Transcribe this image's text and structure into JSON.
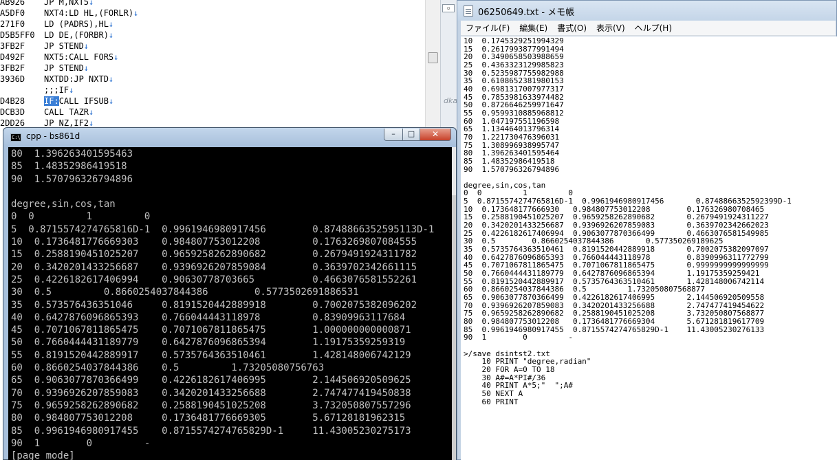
{
  "background_editor": {
    "lines": [
      {
        "addr": "AB926",
        "code": "JP M,NXT5"
      },
      {
        "addr": "A5DF0",
        "code": "NXT4:LD HL,(FORLR)"
      },
      {
        "addr": "271F0",
        "code": "LD (PADRS),HL"
      },
      {
        "addr": "D5B5FF0",
        "code": "LD DE,(FORBR)"
      },
      {
        "addr": "3FB2F",
        "code": "JP STEND"
      },
      {
        "addr": "D492F",
        "code": "NXT5:CALL FORS"
      },
      {
        "addr": "3FB2F",
        "code": "JP STEND"
      },
      {
        "addr": "3936D",
        "code": "NXTDD:JP NXTD"
      },
      {
        "addr": "",
        "code": ";;;IF"
      },
      {
        "addr": "D4B28",
        "code_hl": "IF:",
        "code": "CALL IFSUB"
      },
      {
        "addr": "DCB3D",
        "code": "CALL TAZR"
      },
      {
        "addr": "2DD26",
        "code": "JP NZ,IF2"
      }
    ],
    "arrow": "↓",
    "strip_fragment": "dka"
  },
  "notepad": {
    "title": "06250649.txt - メモ帳",
    "menu": [
      "ファイル(F)",
      "編集(E)",
      "書式(O)",
      "表示(V)",
      "ヘルプ(H)"
    ],
    "content": "10  0.1745329251994329\n15  0.2617993877991494\n20  0.3490658503988659\n25  0.4363323129985823\n30  0.5235987755982988\n35  0.6108652381980153\n40  0.6981317007977317\n45  0.7853981633974482\n50  0.8726646259971647\n55  0.9599310885968812\n60  1.047197551196598\n65  1.134464013796314\n70  1.221730476396031\n75  1.308996938995747\n80  1.396263401595464\n85  1.48352986419518\n90  1.570796326794896\n\ndegree,sin,cos,tan\n0  0         1         0\n5  0.8715574274765816D-1  0.9961946980917456       0.8748866352592399D-1\n10  0.173648177666930   0.984807753012208        0.176326980708465\n15  0.2588190451025207  0.9659258262890682       0.2679491924311227\n20  0.3420201433256687  0.9396926207859083       0.3639702342662023\n25  0.4226182617406994  0.9063077870366499       0.4663076581549985\n30  0.5        0.8660254037844386       0.577350269189625\n35  0.5735764363510461  0.8191520442889918       0.7002075382097097\n40  0.6427876096865393  0.766044443118978        0.8390996311772799\n45  0.7071067811865475  0.7071067811865475       0.9999999999999999\n50  0.7660444431189779  0.6427876096865394       1.19175359259421\n55  0.8191520442889917  0.5735764363510461       1.428148006742114\n60  0.8660254037844386  0.5         1.732050807568877\n65  0.9063077870366499  0.4226182617406995       2.144506920509558\n70  0.9396926207859083  0.3420201433256688       2.747477419454622\n75  0.9659258262890682  0.2588190451025208       3.732050807568877\n80  0.984807753012208   0.1736481776669304       5.671281819617709\n85  0.9961946980917455  0.8715574274765829D-1    11.43005230276133\n90  1        0         -\n\n>/save dsintst2.txt\n    10 PRINT \"degree,radian\"\n    20 FOR A=0 TO 18\n    30 A#=A*PI#/36\n    40 PRINT A*5;\"  \";A#\n    50 NEXT A\n    60 PRINT"
  },
  "console": {
    "title": "cpp - bs861d",
    "icon_text": "C:\\",
    "buttons": {
      "minimize": "–",
      "maximize": "□",
      "close": "✕"
    },
    "content": "80  1.396263401595463\n85  1.48352986419518\n90  1.570796326794896\n\ndegree,sin,cos,tan\n0  0         1         0\n5  0.8715574274765816D-1  0.9961946980917456        0.8748866352595113D-1\n10  0.1736481776669303    0.984807753012208         0.1763269807084555\n15  0.2588190451025207    0.9659258262890682        0.2679491924311782\n20  0.3420201433256687    0.9396926207859084        0.3639702342661115\n25  0.4226182617406994    0.90630778703665          0.4663076581552261\n30  0.5         0.8660254037844386        0.5773502691886531\n35  0.573576436351046     0.8191520442889918        0.7002075382096202\n40  0.6427876096865393    0.766044443118978         0.83909963117684\n45  0.7071067811865475    0.7071067811865475        1.000000000000871\n50  0.7660444431189779    0.6427876096865394        1.19175359259319\n55  0.8191520442889917    0.5735764363510461        1.428148006742129\n60  0.8660254037844386    0.5         1.73205080756763\n65  0.9063077870366499    0.4226182617406995        2.144506920509625\n70  0.9396926207859083    0.3420201433256688        2.747477419450838\n75  0.9659258262890682    0.2588190451025208        3.732050807557296\n80  0.984807753012208     0.1736481776669305        5.67128181962315\n85  0.9961946980917455    0.8715574274765829D-1     11.43005230275173\n90  1        0         -\n[page mode]"
  }
}
